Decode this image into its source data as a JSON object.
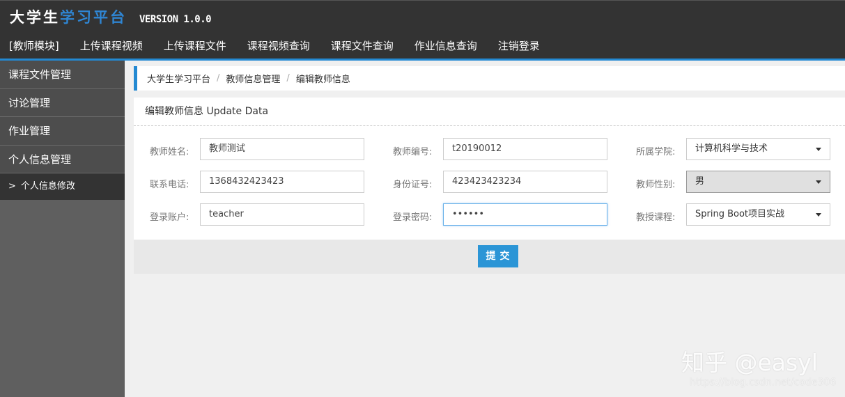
{
  "header": {
    "brand_main": "大学生",
    "brand_accent": "学习平台",
    "version": "VERSION 1.0.0",
    "nav": [
      "[教师模块]",
      "上传课程视频",
      "上传课程文件",
      "课程视频查询",
      "课程文件查询",
      "作业信息查询",
      "注销登录"
    ]
  },
  "sidebar": {
    "items": [
      "课程文件管理",
      "讨论管理",
      "作业管理",
      "个人信息管理"
    ],
    "active_arrow": ">",
    "active_label": "个人信息修改"
  },
  "breadcrumb": [
    "大学生学习平台",
    "教师信息管理",
    "编辑教师信息"
  ],
  "breadcrumb_sep": "/",
  "panel": {
    "title": "编辑教师信息 Update Data"
  },
  "form": {
    "name_label": "教师姓名:",
    "name_value": "教师测试",
    "id_label": "教师编号:",
    "id_value": "t20190012",
    "college_label": "所属学院:",
    "college_value": "计算机科学与技术",
    "phone_label": "联系电话:",
    "phone_value": "1368432423423",
    "idcard_label": "身份证号:",
    "idcard_value": "423423423234",
    "gender_label": "教师性别:",
    "gender_value": "男",
    "account_label": "登录账户:",
    "account_value": "teacher",
    "password_label": "登录密码:",
    "password_value": "••••••",
    "course_label": "教授课程:",
    "course_value": "Spring Boot项目实战"
  },
  "submit_label": "提交",
  "watermark": {
    "zhihu": "知乎 @easyl",
    "csdn": "https://blog.csdn.net/code306"
  },
  "colors": {
    "accent": "#2389d2",
    "header_bg": "#333333",
    "submit_bg": "#2b95d6"
  }
}
